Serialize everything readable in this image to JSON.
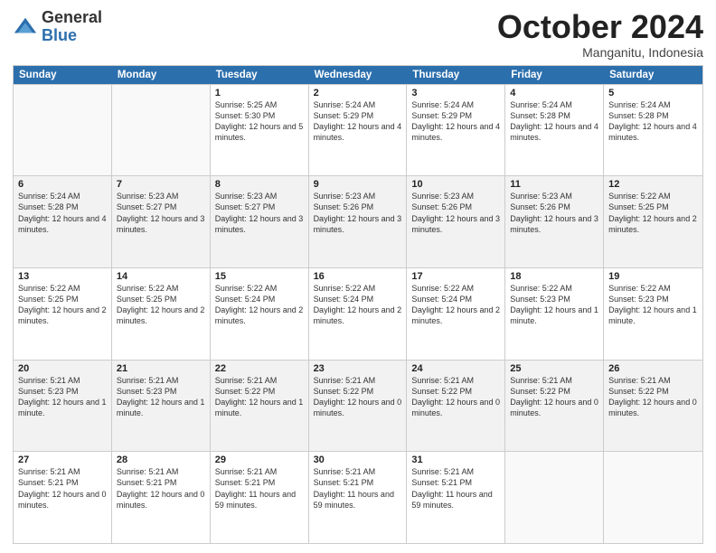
{
  "logo": {
    "general": "General",
    "blue": "Blue"
  },
  "title": "October 2024",
  "location": "Manganitu, Indonesia",
  "header_days": [
    "Sunday",
    "Monday",
    "Tuesday",
    "Wednesday",
    "Thursday",
    "Friday",
    "Saturday"
  ],
  "weeks": [
    [
      {
        "day": "",
        "detail": "",
        "empty": true
      },
      {
        "day": "",
        "detail": "",
        "empty": true
      },
      {
        "day": "1",
        "detail": "Sunrise: 5:25 AM\nSunset: 5:30 PM\nDaylight: 12 hours and 5 minutes."
      },
      {
        "day": "2",
        "detail": "Sunrise: 5:24 AM\nSunset: 5:29 PM\nDaylight: 12 hours and 4 minutes."
      },
      {
        "day": "3",
        "detail": "Sunrise: 5:24 AM\nSunset: 5:29 PM\nDaylight: 12 hours and 4 minutes."
      },
      {
        "day": "4",
        "detail": "Sunrise: 5:24 AM\nSunset: 5:28 PM\nDaylight: 12 hours and 4 minutes."
      },
      {
        "day": "5",
        "detail": "Sunrise: 5:24 AM\nSunset: 5:28 PM\nDaylight: 12 hours and 4 minutes."
      }
    ],
    [
      {
        "day": "6",
        "detail": "Sunrise: 5:24 AM\nSunset: 5:28 PM\nDaylight: 12 hours and 4 minutes.",
        "shaded": true
      },
      {
        "day": "7",
        "detail": "Sunrise: 5:23 AM\nSunset: 5:27 PM\nDaylight: 12 hours and 3 minutes.",
        "shaded": true
      },
      {
        "day": "8",
        "detail": "Sunrise: 5:23 AM\nSunset: 5:27 PM\nDaylight: 12 hours and 3 minutes.",
        "shaded": true
      },
      {
        "day": "9",
        "detail": "Sunrise: 5:23 AM\nSunset: 5:26 PM\nDaylight: 12 hours and 3 minutes.",
        "shaded": true
      },
      {
        "day": "10",
        "detail": "Sunrise: 5:23 AM\nSunset: 5:26 PM\nDaylight: 12 hours and 3 minutes.",
        "shaded": true
      },
      {
        "day": "11",
        "detail": "Sunrise: 5:23 AM\nSunset: 5:26 PM\nDaylight: 12 hours and 3 minutes.",
        "shaded": true
      },
      {
        "day": "12",
        "detail": "Sunrise: 5:22 AM\nSunset: 5:25 PM\nDaylight: 12 hours and 2 minutes.",
        "shaded": true
      }
    ],
    [
      {
        "day": "13",
        "detail": "Sunrise: 5:22 AM\nSunset: 5:25 PM\nDaylight: 12 hours and 2 minutes."
      },
      {
        "day": "14",
        "detail": "Sunrise: 5:22 AM\nSunset: 5:25 PM\nDaylight: 12 hours and 2 minutes."
      },
      {
        "day": "15",
        "detail": "Sunrise: 5:22 AM\nSunset: 5:24 PM\nDaylight: 12 hours and 2 minutes."
      },
      {
        "day": "16",
        "detail": "Sunrise: 5:22 AM\nSunset: 5:24 PM\nDaylight: 12 hours and 2 minutes."
      },
      {
        "day": "17",
        "detail": "Sunrise: 5:22 AM\nSunset: 5:24 PM\nDaylight: 12 hours and 2 minutes."
      },
      {
        "day": "18",
        "detail": "Sunrise: 5:22 AM\nSunset: 5:23 PM\nDaylight: 12 hours and 1 minute."
      },
      {
        "day": "19",
        "detail": "Sunrise: 5:22 AM\nSunset: 5:23 PM\nDaylight: 12 hours and 1 minute."
      }
    ],
    [
      {
        "day": "20",
        "detail": "Sunrise: 5:21 AM\nSunset: 5:23 PM\nDaylight: 12 hours and 1 minute.",
        "shaded": true
      },
      {
        "day": "21",
        "detail": "Sunrise: 5:21 AM\nSunset: 5:23 PM\nDaylight: 12 hours and 1 minute.",
        "shaded": true
      },
      {
        "day": "22",
        "detail": "Sunrise: 5:21 AM\nSunset: 5:22 PM\nDaylight: 12 hours and 1 minute.",
        "shaded": true
      },
      {
        "day": "23",
        "detail": "Sunrise: 5:21 AM\nSunset: 5:22 PM\nDaylight: 12 hours and 0 minutes.",
        "shaded": true
      },
      {
        "day": "24",
        "detail": "Sunrise: 5:21 AM\nSunset: 5:22 PM\nDaylight: 12 hours and 0 minutes.",
        "shaded": true
      },
      {
        "day": "25",
        "detail": "Sunrise: 5:21 AM\nSunset: 5:22 PM\nDaylight: 12 hours and 0 minutes.",
        "shaded": true
      },
      {
        "day": "26",
        "detail": "Sunrise: 5:21 AM\nSunset: 5:22 PM\nDaylight: 12 hours and 0 minutes.",
        "shaded": true
      }
    ],
    [
      {
        "day": "27",
        "detail": "Sunrise: 5:21 AM\nSunset: 5:21 PM\nDaylight: 12 hours and 0 minutes."
      },
      {
        "day": "28",
        "detail": "Sunrise: 5:21 AM\nSunset: 5:21 PM\nDaylight: 12 hours and 0 minutes."
      },
      {
        "day": "29",
        "detail": "Sunrise: 5:21 AM\nSunset: 5:21 PM\nDaylight: 11 hours and 59 minutes."
      },
      {
        "day": "30",
        "detail": "Sunrise: 5:21 AM\nSunset: 5:21 PM\nDaylight: 11 hours and 59 minutes."
      },
      {
        "day": "31",
        "detail": "Sunrise: 5:21 AM\nSunset: 5:21 PM\nDaylight: 11 hours and 59 minutes."
      },
      {
        "day": "",
        "detail": "",
        "empty": true
      },
      {
        "day": "",
        "detail": "",
        "empty": true
      }
    ]
  ]
}
